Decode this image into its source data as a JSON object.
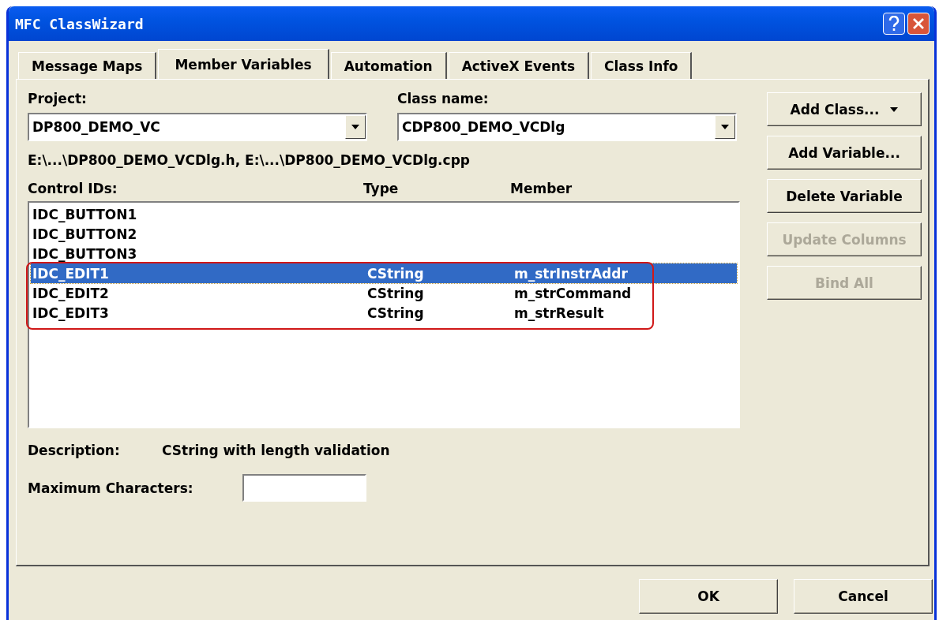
{
  "window": {
    "title": "MFC ClassWizard"
  },
  "tabs": [
    {
      "label": "Message Maps",
      "selected": false
    },
    {
      "label": "Member Variables",
      "selected": true
    },
    {
      "label": "Automation",
      "selected": false
    },
    {
      "label": "ActiveX Events",
      "selected": false
    },
    {
      "label": "Class Info",
      "selected": false
    }
  ],
  "project": {
    "label": "Project:",
    "value": "DP800_DEMO_VC"
  },
  "class_name": {
    "label": "Class name:",
    "value": "CDP800_DEMO_VCDlg"
  },
  "files": "E:\\...\\DP800_DEMO_VCDlg.h, E:\\...\\DP800_DEMO_VCDlg.cpp",
  "table": {
    "columns": [
      {
        "label": "Control IDs:"
      },
      {
        "label": "Type"
      },
      {
        "label": "Member"
      }
    ],
    "rows": [
      {
        "id": "IDC_BUTTON1",
        "selected": false
      },
      {
        "id": "IDC_BUTTON2",
        "selected": false
      },
      {
        "id": "IDC_BUTTON3",
        "selected": false
      },
      {
        "id": "IDC_EDIT1",
        "type": "CString",
        "member": "m_strInstrAddr",
        "selected": true
      },
      {
        "id": "IDC_EDIT2",
        "type": "CString",
        "member": "m_strCommand",
        "selected": false
      },
      {
        "id": "IDC_EDIT3",
        "type": "CString",
        "member": "m_strResult",
        "selected": false
      }
    ]
  },
  "description": {
    "label": "Description:",
    "value": "CString with length validation"
  },
  "max_chars": {
    "label": "Maximum Characters:"
  },
  "side_buttons": [
    {
      "label": "Add Class...",
      "dropdown": true,
      "disabled": false
    },
    {
      "label": "Add Variable...",
      "dropdown": false,
      "disabled": false
    },
    {
      "label": "Delete Variable",
      "dropdown": false,
      "disabled": false
    },
    {
      "label": "Update Columns",
      "dropdown": false,
      "disabled": true
    },
    {
      "label": "Bind All",
      "dropdown": false,
      "disabled": true
    }
  ],
  "buttons": [
    {
      "label": "OK"
    },
    {
      "label": "Cancel"
    }
  ]
}
